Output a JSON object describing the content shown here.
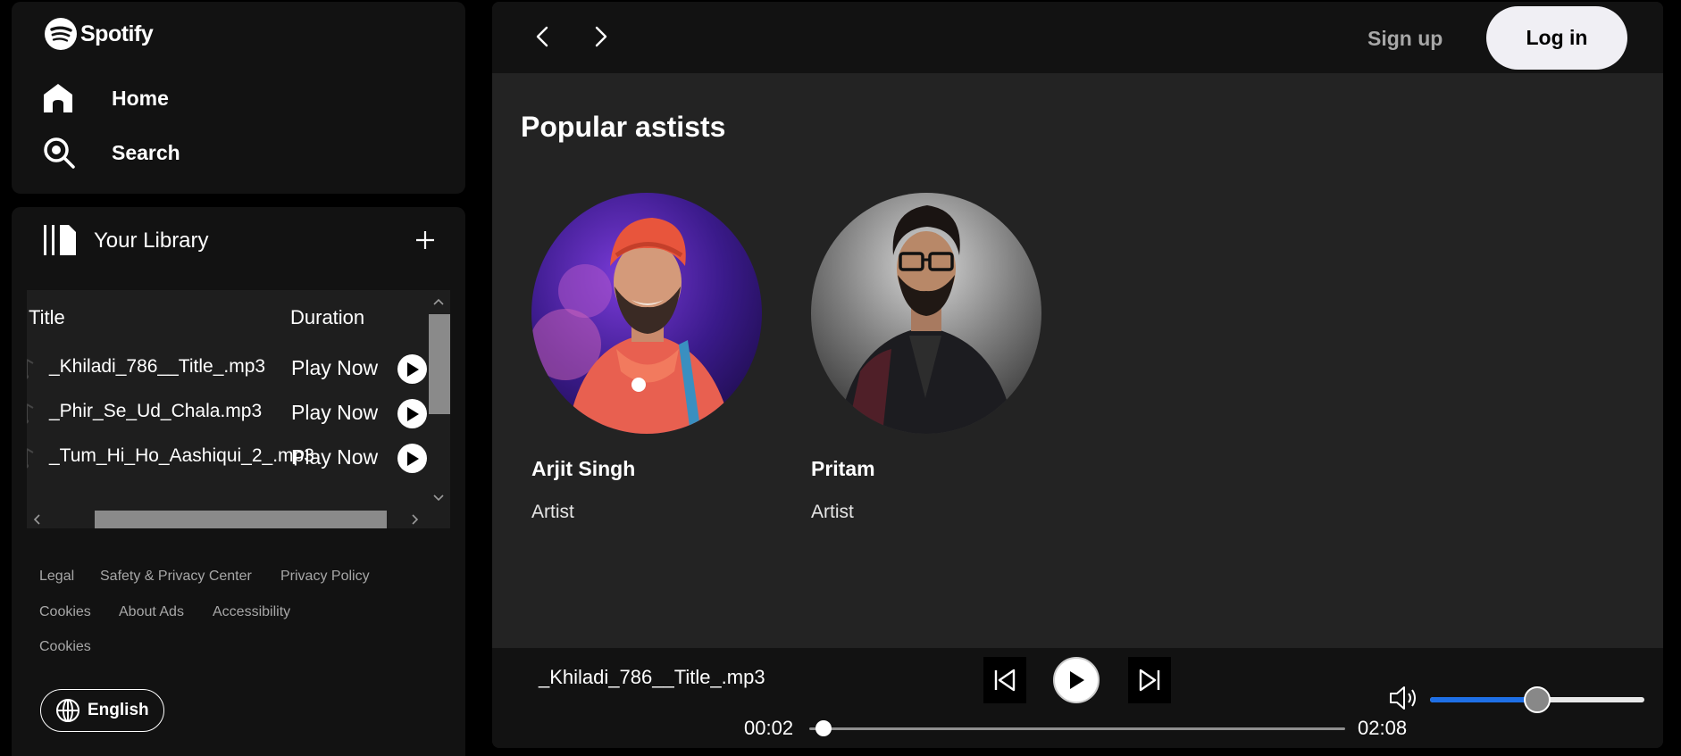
{
  "brand": {
    "name": "Spotify"
  },
  "nav": {
    "home_label": "Home",
    "search_label": "Search"
  },
  "library": {
    "label": "Your Library",
    "columns": {
      "title": "Title",
      "duration": "Duration"
    },
    "tracks": [
      {
        "title": "_Khiladi_786__Title_.mp3",
        "action": "Play Now"
      },
      {
        "title": "_Phir_Se_Ud_Chala.mp3",
        "action": "Play Now"
      },
      {
        "title": "_Tum_Hi_Ho_Aashiqui_2_.mp3",
        "action": "Play Now"
      }
    ]
  },
  "footer": {
    "links": [
      "Legal",
      "Safety & Privacy Center",
      "Privacy Policy",
      "Cookies",
      "About Ads",
      "Accessibility",
      "Cookies"
    ],
    "language": "English"
  },
  "header": {
    "signup_label": "Sign up",
    "login_label": "Log in"
  },
  "main": {
    "section_title": "Popular astists",
    "artists": [
      {
        "name": "Arjit Singh",
        "role": "Artist"
      },
      {
        "name": "Pritam",
        "role": "Artist"
      }
    ]
  },
  "player": {
    "now_playing": "_Khiladi_786__Title_.mp3",
    "elapsed": "00:02",
    "total": "02:08",
    "progress_fraction": 0.016,
    "volume_fraction": 0.5
  },
  "colors": {
    "background": "#000000",
    "panel": "#121212",
    "main_panel": "#232323",
    "volume_accent": "#1e6fe6",
    "login_button": "#f0eff4"
  }
}
